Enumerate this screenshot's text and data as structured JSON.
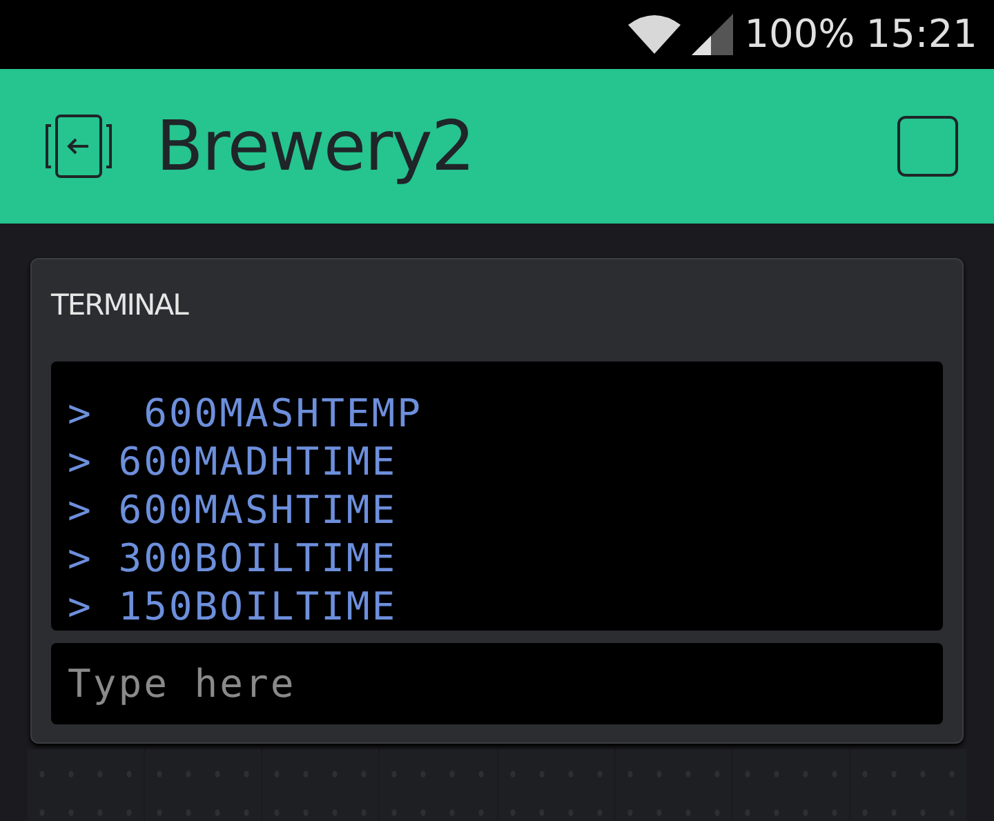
{
  "status_bar": {
    "battery": "100%",
    "time": "15:21"
  },
  "header": {
    "title": "Brewery2"
  },
  "terminal": {
    "title": "TERMINAL",
    "lines": [
      ">  600MASHTEMP",
      "> 600MADHTIME",
      "> 600MASHTIME",
      "> 300BOILTIME",
      "> 150BOILTIME"
    ],
    "input": {
      "placeholder": "Type here"
    }
  }
}
